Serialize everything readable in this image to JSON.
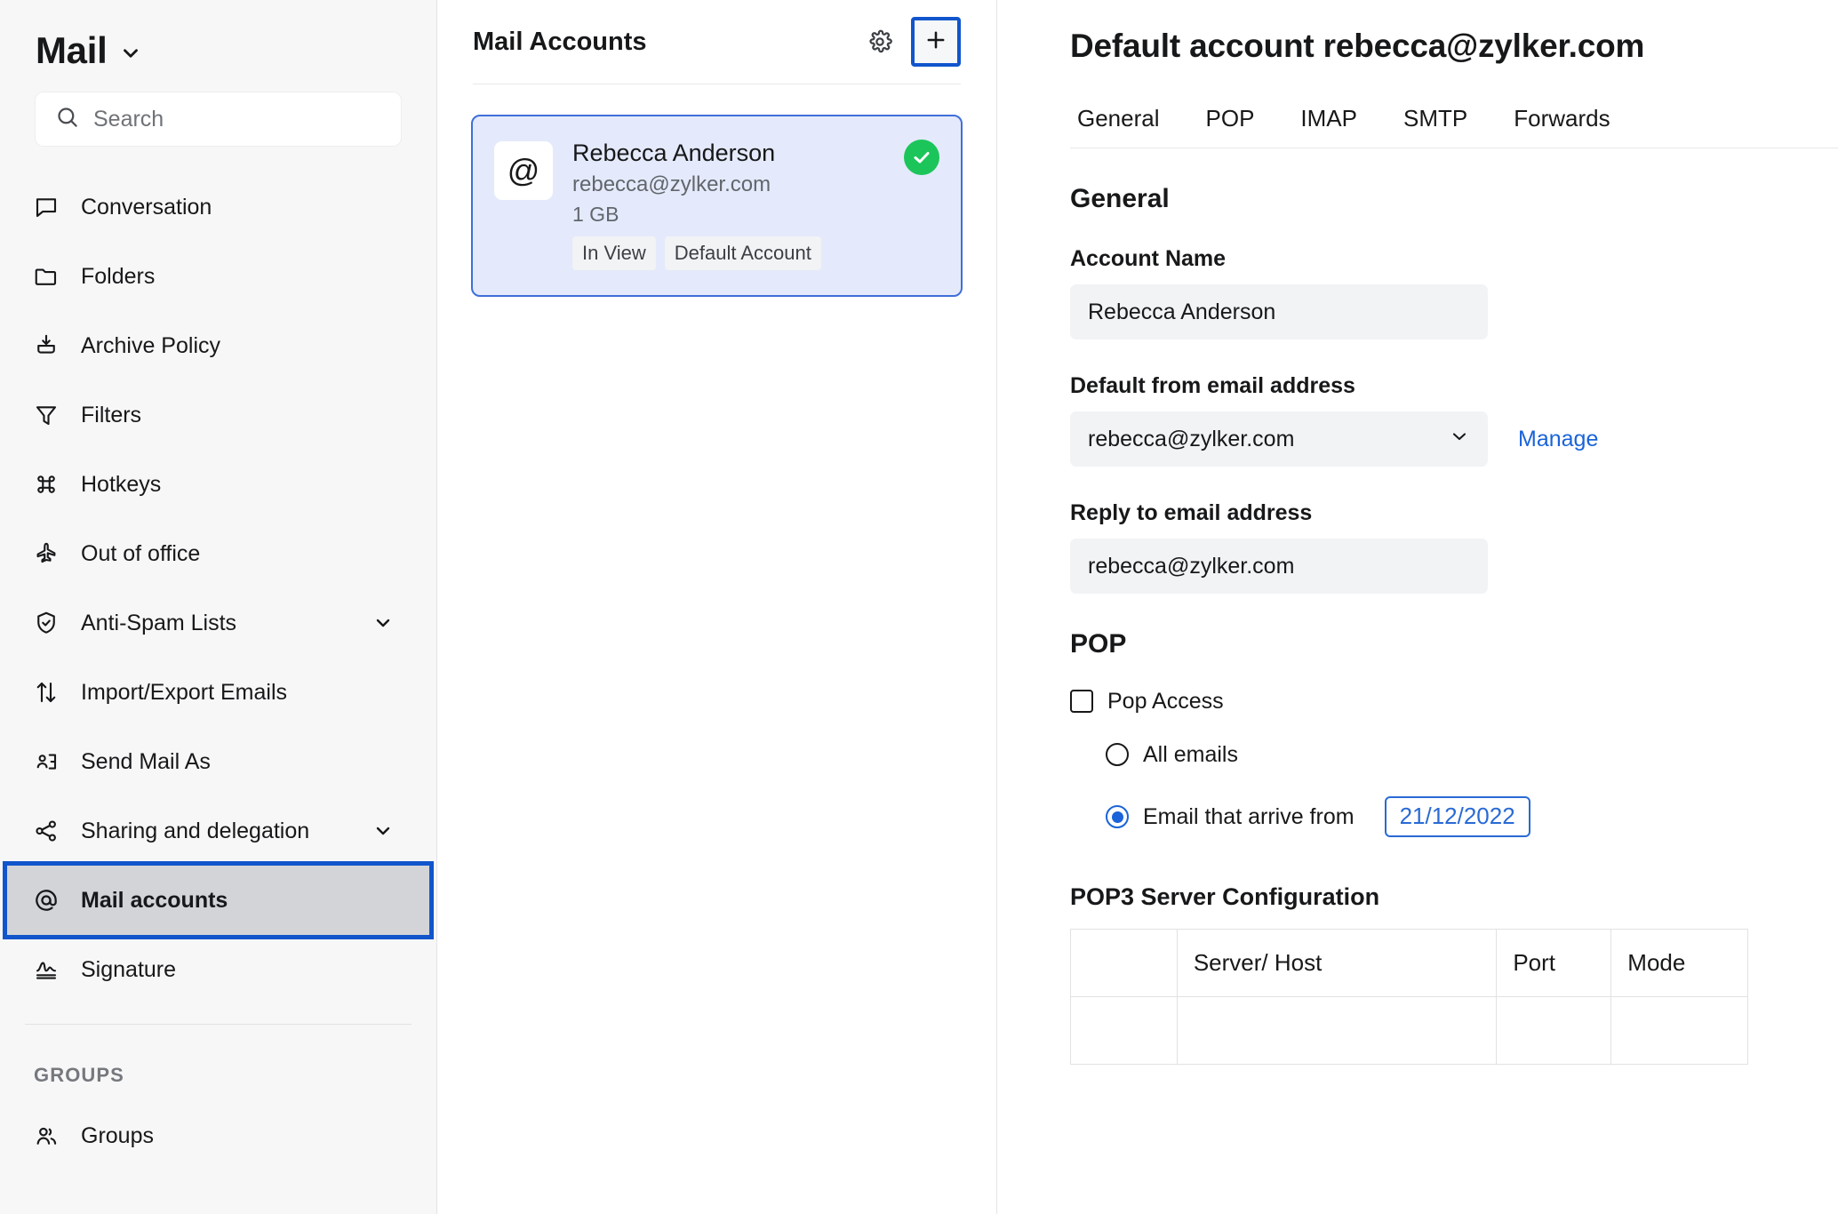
{
  "sidebar": {
    "brand": "Mail",
    "search": {
      "placeholder": "Search",
      "value": ""
    },
    "items": [
      {
        "label": "Conversation",
        "icon": "conversation-icon",
        "chevron": false
      },
      {
        "label": "Folders",
        "icon": "folder-icon",
        "chevron": false
      },
      {
        "label": "Archive Policy",
        "icon": "archive-icon",
        "chevron": false
      },
      {
        "label": "Filters",
        "icon": "filter-icon",
        "chevron": false
      },
      {
        "label": "Hotkeys",
        "icon": "command-icon",
        "chevron": false
      },
      {
        "label": "Out of office",
        "icon": "airplane-icon",
        "chevron": false
      },
      {
        "label": "Anti-Spam Lists",
        "icon": "shield-check-icon",
        "chevron": true
      },
      {
        "label": "Import/Export Emails",
        "icon": "arrows-up-down-icon",
        "chevron": false
      },
      {
        "label": "Send Mail As",
        "icon": "user-card-icon",
        "chevron": false
      },
      {
        "label": "Sharing and delegation",
        "icon": "share-icon",
        "chevron": true
      },
      {
        "label": "Mail accounts",
        "icon": "at-icon",
        "chevron": false,
        "selected": true
      },
      {
        "label": "Signature",
        "icon": "signature-icon",
        "chevron": false
      }
    ],
    "groups_heading": "GROUPS",
    "groups_items": [
      {
        "label": "Groups",
        "icon": "people-icon"
      }
    ]
  },
  "accounts_panel": {
    "title": "Mail Accounts",
    "settings_icon": "gear-icon",
    "add_icon": "plus-icon",
    "accounts": [
      {
        "avatar_glyph": "@",
        "name": "Rebecca Anderson",
        "email": "rebecca@zylker.com",
        "size": "1 GB",
        "tags": [
          "In View",
          "Default Account"
        ],
        "verified": true,
        "selected": true
      }
    ]
  },
  "detail": {
    "title": "Default account rebecca@zylker.com",
    "tabs": [
      {
        "label": "General",
        "active": true
      },
      {
        "label": "POP",
        "active": false
      },
      {
        "label": "IMAP",
        "active": false
      },
      {
        "label": "SMTP",
        "active": false
      },
      {
        "label": "Forwards",
        "active": false
      }
    ],
    "general": {
      "heading": "General",
      "account_name_label": "Account Name",
      "account_name_value": "Rebecca Anderson",
      "default_from_label": "Default from email address",
      "default_from_value": "rebecca@zylker.com",
      "manage_link": "Manage",
      "reply_to_label": "Reply to email address",
      "reply_to_value": "rebecca@zylker.com"
    },
    "pop": {
      "heading": "POP",
      "pop_access_label": "Pop Access",
      "pop_access_checked": false,
      "option_all_label": "All emails",
      "option_all_selected": false,
      "option_from_label": "Email that arrive from",
      "option_from_selected": true,
      "from_date": "21/12/2022",
      "table_title": "POP3 Server Configuration",
      "table_headers": [
        "",
        "Server/ Host",
        "Port",
        "Mode"
      ],
      "table_rows": [
        [
          "",
          "",
          "",
          ""
        ]
      ]
    }
  },
  "colors": {
    "accent_blue": "#1155cc",
    "link_blue": "#1a63d8",
    "selected_card_bg": "#e4eafb",
    "selected_card_border": "#3f6fd8",
    "verified_green": "#1bc55a",
    "sidebar_bg": "#f7f7f8",
    "selected_nav_bg": "#d2d4d8"
  }
}
